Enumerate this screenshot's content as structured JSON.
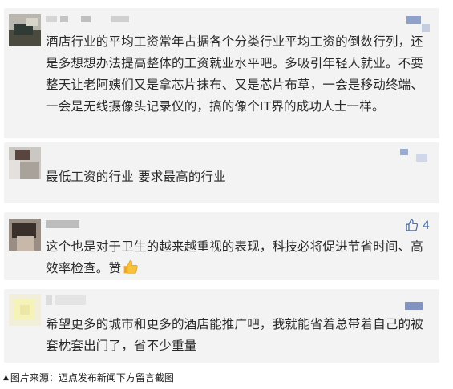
{
  "comments": [
    {
      "text": "酒店行业的平均工资常年占据各个分类行业平均工资的倒数行列，还是多想想办法提高整体的工资就业水平吧。多吸引年轻人就业。不要整天让老阿姨们又是拿芯片抹布、又是芯片布草，一会是移动终端、一会是无线摄像头记录仪的，搞的像个IT界的成功人士一样。"
    },
    {
      "text": "最低工资的行业 要求最高的行业"
    },
    {
      "text": "这个也是对于卫生的越来越重视的表现，科技必将促进节省时间、高效率检查。赞",
      "likes": "4",
      "emoji": "thumbs-up"
    },
    {
      "text": "希望更多的城市和更多的酒店能推广吧，我就能省着总带着自己的被套枕套出门了，省不少重量"
    }
  ],
  "caption": {
    "marker": "▲",
    "text": "图片来源：迈点发布新闻下方留言截图"
  },
  "colors": {
    "card_bg": "#f3f3f3",
    "text": "#2a2a2a",
    "like_blue": "#4a6ea9",
    "caption_highlight": "#fff36b"
  },
  "icons": [
    "thumbs-up-outline-icon",
    "thumbs-up-emoji-icon"
  ]
}
